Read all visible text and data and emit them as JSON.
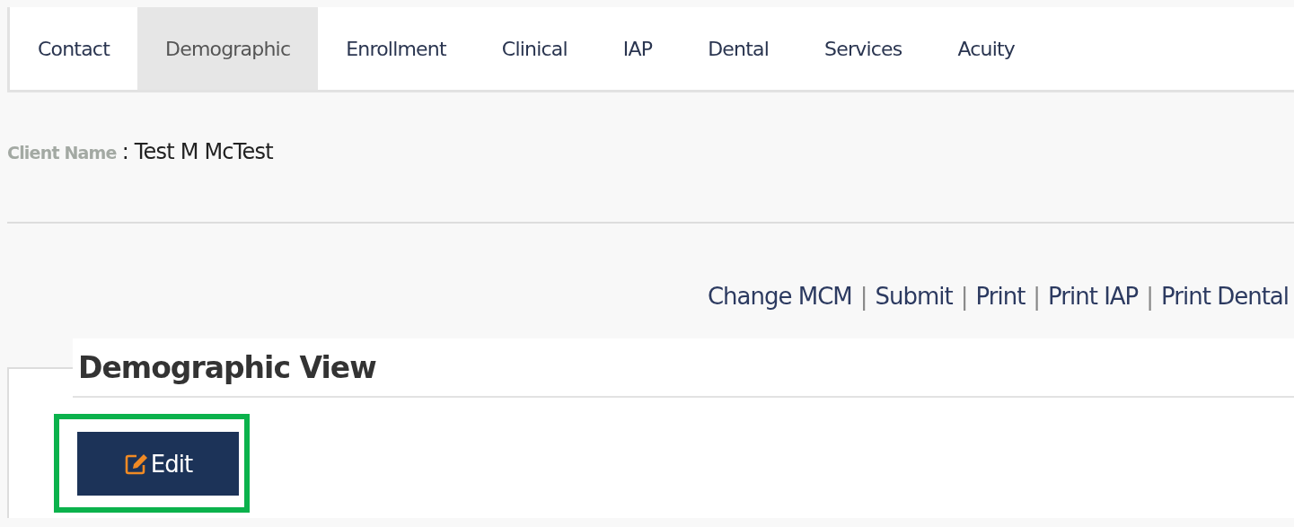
{
  "tabs": [
    {
      "label": "Contact",
      "selected": false
    },
    {
      "label": "Demographic",
      "selected": true
    },
    {
      "label": "Enrollment",
      "selected": false
    },
    {
      "label": "Clinical",
      "selected": false
    },
    {
      "label": "IAP",
      "selected": false
    },
    {
      "label": "Dental",
      "selected": false
    },
    {
      "label": "Services",
      "selected": false
    },
    {
      "label": "Acuity",
      "selected": false
    }
  ],
  "client": {
    "label": "Client Name",
    "value": ": Test M McTest"
  },
  "actions": [
    {
      "kind": "link",
      "text": "Change MCM"
    },
    {
      "kind": "separator",
      "text": "|"
    },
    {
      "kind": "link",
      "text": "Submit"
    },
    {
      "kind": "separator",
      "text": "|"
    },
    {
      "kind": "link",
      "text": "Print"
    },
    {
      "kind": "separator",
      "text": "|"
    },
    {
      "kind": "link",
      "text": "Print IAP"
    },
    {
      "kind": "separator",
      "text": "|"
    },
    {
      "kind": "link",
      "text": "Print Dental"
    }
  ],
  "panel": {
    "title": "Demographic View",
    "edit_button": {
      "label": "Edit",
      "highlighted": true
    }
  }
}
